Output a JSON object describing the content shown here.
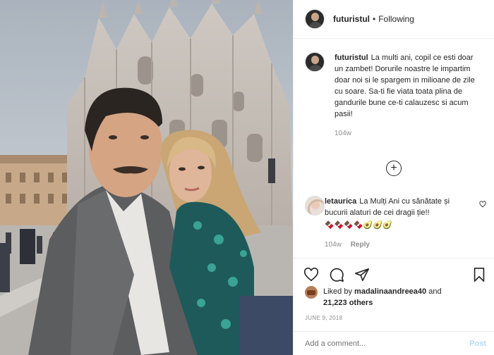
{
  "header": {
    "username": "futuristul",
    "separator": "•",
    "follow_status": "Following"
  },
  "caption": {
    "username": "futuristul",
    "text": "La multi ani, copil ce esti doar un zambet! Dorurile noastre le impartim doar noi si le spargem in milioane de zile cu soare. Sa-ti fie viata toata plina de gandurile bune ce-ti calauzesc si acum pasii!",
    "time": "104w"
  },
  "load_more_symbol": "+",
  "comments": [
    {
      "username": "letaurica",
      "text": "La Mulți Ani cu sănătate și bucurii alaturi de cei dragii ție!!",
      "emojis": "🍫🍫🍫🍫🥑🥑🥑",
      "time": "104w",
      "reply_label": "Reply"
    }
  ],
  "likes": {
    "prefix": "Liked by",
    "user": "madalinaandreea40",
    "joiner": "and",
    "count": "21,223 others"
  },
  "date": "JUNE 9, 2018",
  "add_comment": {
    "placeholder": "Add a comment...",
    "post_label": "Post"
  },
  "icons": {
    "like": "heart-icon",
    "comment": "comment-icon",
    "share": "paper-plane-icon",
    "save": "bookmark-icon"
  }
}
